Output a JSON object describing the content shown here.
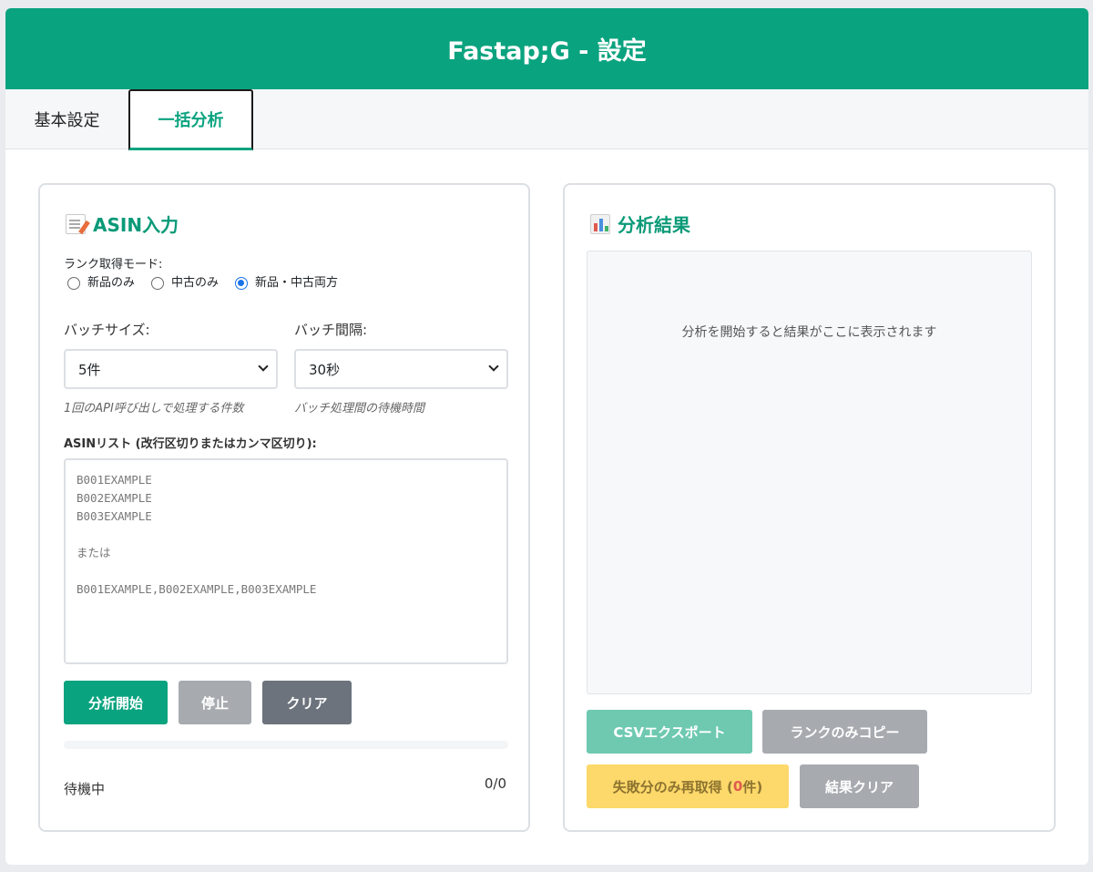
{
  "header": {
    "title": "Fastap;G - 設定"
  },
  "tabs": [
    {
      "label": "基本設定"
    },
    {
      "label": "一括分析"
    }
  ],
  "left_panel": {
    "title": "ASIN入力",
    "icon": "memo-icon",
    "rank_mode": {
      "label": "ランク取得モード:",
      "options": [
        "新品のみ",
        "中古のみ",
        "新品・中古両方"
      ],
      "selected": "新品・中古両方"
    },
    "batch_size": {
      "label": "バッチサイズ:",
      "value": "5件",
      "hint": "1回のAPI呼び出しで処理する件数"
    },
    "batch_interval": {
      "label": "バッチ間隔:",
      "value": "30秒",
      "hint": "バッチ処理間の待機時間"
    },
    "asin_list": {
      "label": "ASINリスト (改行区切りまたはカンマ区切り):",
      "placeholder": "B001EXAMPLE\nB002EXAMPLE\nB003EXAMPLE\n\nまたは\n\nB001EXAMPLE,B002EXAMPLE,B003EXAMPLE"
    },
    "buttons": {
      "start": "分析開始",
      "stop": "停止",
      "clear": "クリア"
    },
    "progress": 0,
    "status": "待機中",
    "count": "0/0"
  },
  "right_panel": {
    "title": "分析結果",
    "icon": "bar-chart-icon",
    "empty_message": "分析を開始すると結果がここに表示されます",
    "buttons": {
      "csv_export": "CSVエクスポート",
      "copy_rank": "ランクのみコピー",
      "retry_prefix": "失敗分のみ再取得 (",
      "retry_count": "0",
      "retry_suffix": "件)",
      "clear_results": "結果クリア"
    }
  },
  "colors": {
    "brand": "#0aa37f",
    "radio_checked": "#1a73e8",
    "retry_button": "#fdd86a",
    "stop_button": "#a7abb0",
    "clear_button": "#6c737c"
  }
}
